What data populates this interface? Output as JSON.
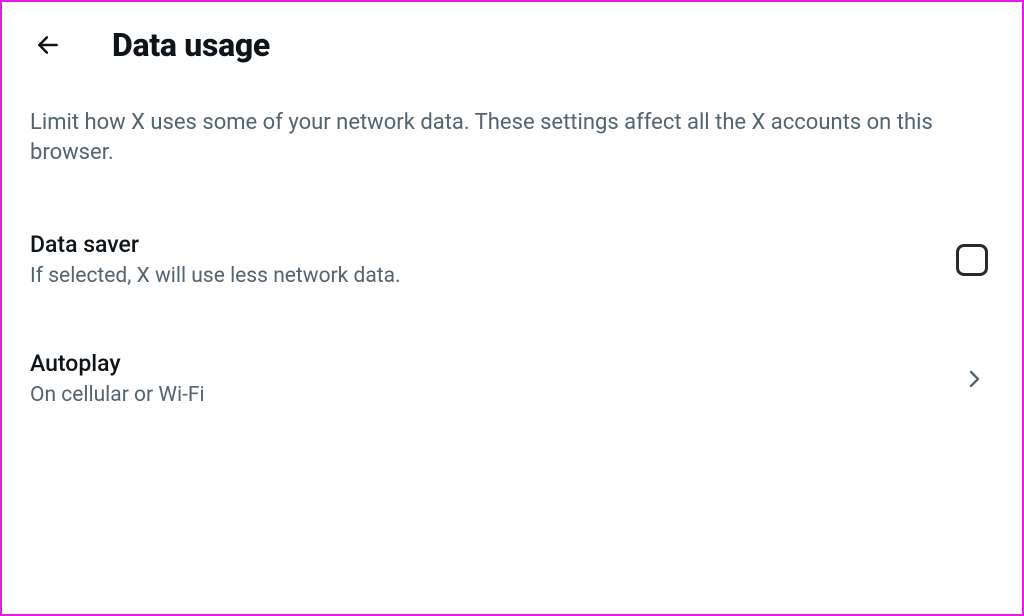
{
  "header": {
    "title": "Data usage"
  },
  "page": {
    "description": "Limit how X uses some of your network data. These settings affect all the X accounts on this browser."
  },
  "settings": {
    "data_saver": {
      "title": "Data saver",
      "subtitle": "If selected, X will use less network data.",
      "checked": false
    },
    "autoplay": {
      "title": "Autoplay",
      "subtitle": "On cellular or Wi-Fi"
    }
  }
}
